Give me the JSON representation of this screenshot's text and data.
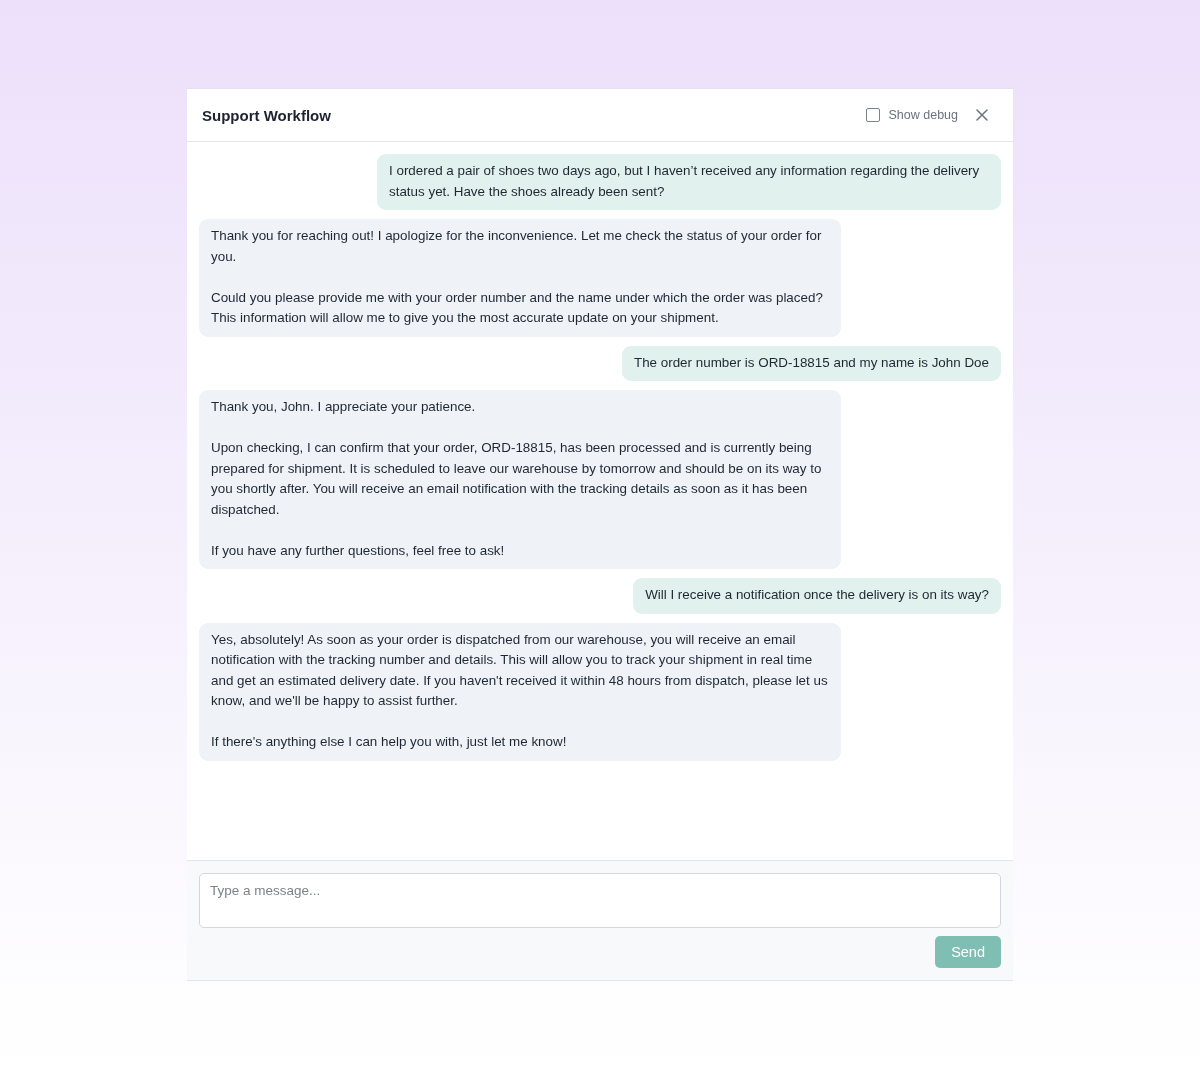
{
  "header": {
    "title": "Support Workflow",
    "debug": {
      "label": "Show debug",
      "checked": false
    }
  },
  "messages": [
    {
      "kind": "user",
      "paragraphs": [
        "I ordered a pair of shoes two days ago, but I haven’t received any information regarding the delivery status yet. Have the shoes already been sent?"
      ]
    },
    {
      "kind": "assistant",
      "paragraphs": [
        "Thank you for reaching out! I apologize for the inconvenience. Let me check the status of your order for you.",
        "Could you please provide me with your order number and the name under which the order was placed? This information will allow me to give you the most accurate update on your shipment."
      ]
    },
    {
      "kind": "user",
      "paragraphs": [
        "The order number is ORD-18815 and my name is John Doe"
      ]
    },
    {
      "kind": "assistant",
      "paragraphs": [
        "Thank you, John. I appreciate your patience.",
        "Upon checking, I can confirm that your order, ORD-18815, has been processed and is currently being prepared for shipment. It is scheduled to leave our warehouse by tomorrow and should be on its way to you shortly after. You will receive an email notification with the tracking details as soon as it has been dispatched.",
        "If you have any further questions, feel free to ask!"
      ]
    },
    {
      "kind": "user",
      "paragraphs": [
        "Will I receive a notification once the delivery is on its way?"
      ]
    },
    {
      "kind": "assistant",
      "paragraphs": [
        "Yes, absolutely! As soon as your order is dispatched from our warehouse, you will receive an email notification with the tracking number and details. This will allow you to track your shipment in real time and get an estimated delivery date. If you haven't received it within 48 hours from dispatch, please let us know, and we'll be happy to assist further.",
        "If there's anything else I can help you with, just let me know!"
      ]
    }
  ],
  "composer": {
    "placeholder": "Type a message...",
    "send": "Send"
  }
}
